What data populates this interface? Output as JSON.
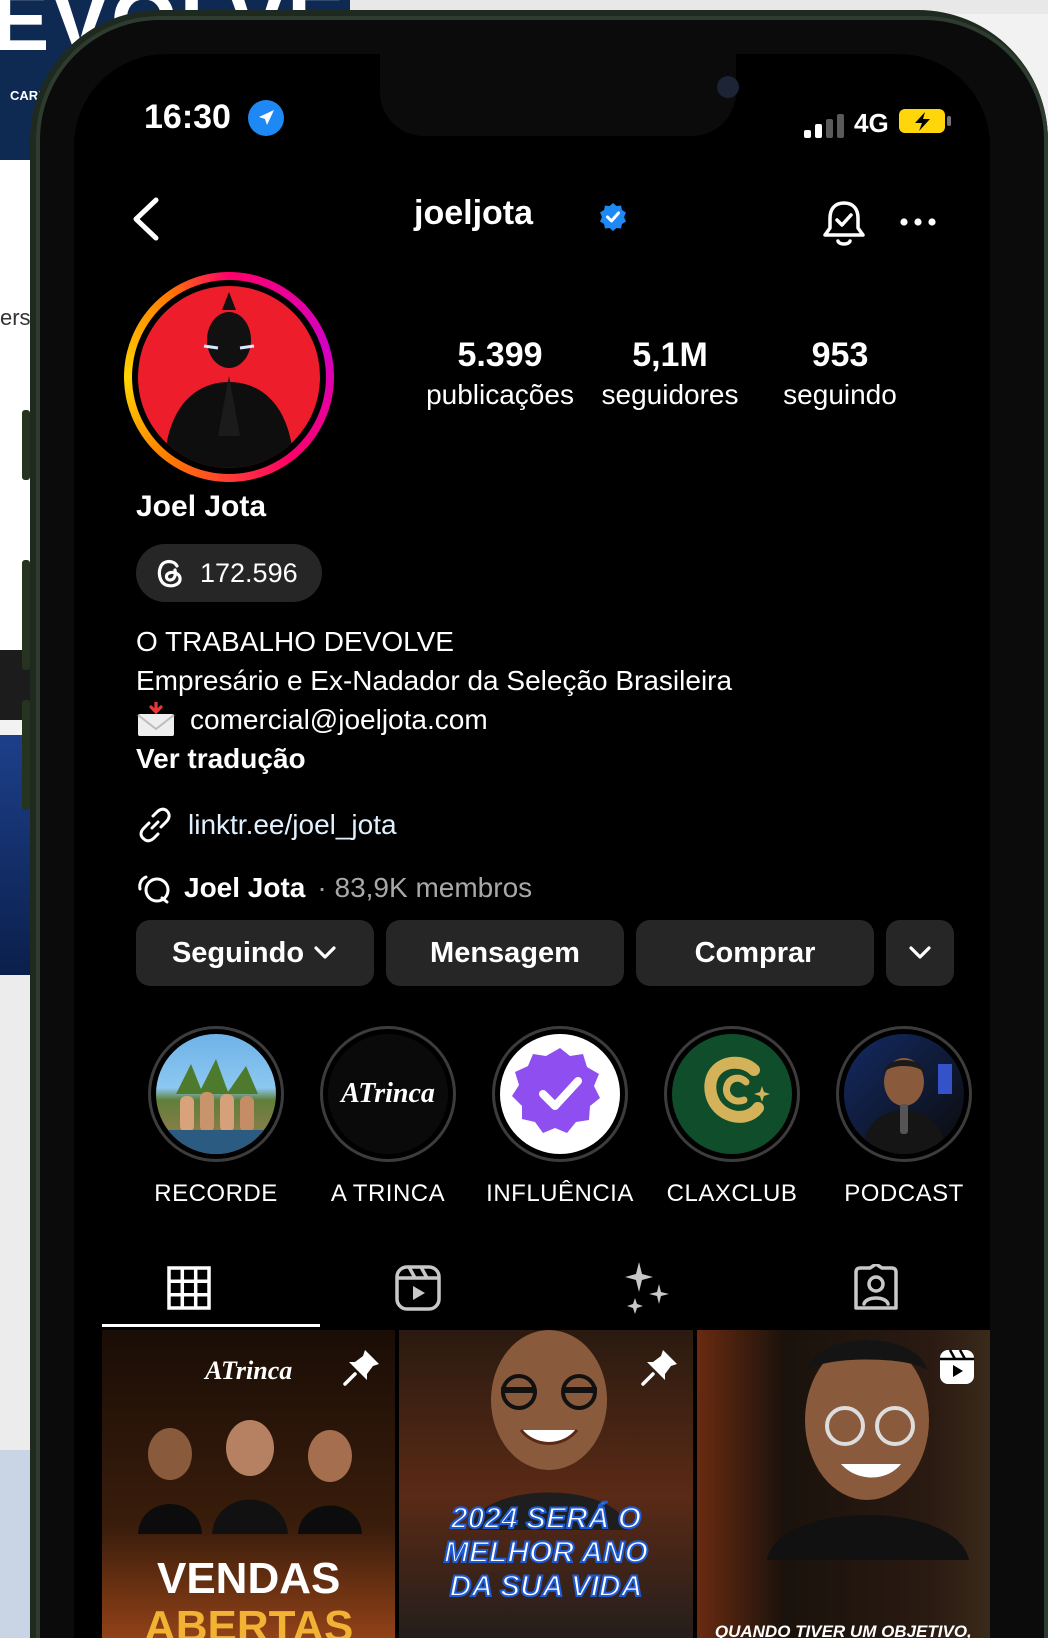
{
  "background": {
    "banner_text": "EVOLVE",
    "strip_text": "CARF",
    "snippet_text": "ersi"
  },
  "status_bar": {
    "time": "16:30",
    "network": "4G"
  },
  "header": {
    "username": "joeljota"
  },
  "profile": {
    "stats": [
      {
        "value": "5.399",
        "label": "publicações"
      },
      {
        "value": "5,1M",
        "label": "seguidores"
      },
      {
        "value": "953",
        "label": "seguindo"
      }
    ],
    "name": "Joel Jota",
    "threads_count": "172.596",
    "bio": {
      "line1": "O TRABALHO DEVOLVE",
      "line2": "Empresário e Ex-Nadador da Seleção Brasileira",
      "email": "comercial@joeljota.com",
      "translate": "Ver tradução"
    },
    "link": "linktr.ee/joel_jota",
    "community": {
      "name": "Joel Jota",
      "meta": "· 83,9K membros"
    }
  },
  "actions": {
    "following": "Seguindo",
    "message": "Mensagem",
    "shop": "Comprar"
  },
  "highlights": [
    {
      "label": "RECORDE"
    },
    {
      "label": "A TRINCA",
      "logo_text": "ATrinca"
    },
    {
      "label": "INFLUÊNCIA"
    },
    {
      "label": "CLAXCLUB"
    },
    {
      "label": "PODCAST"
    }
  ],
  "tabs": [
    "grid-icon",
    "reels-icon",
    "sparkles-icon",
    "tagged-icon"
  ],
  "posts": [
    {
      "top_text": "ATrinca",
      "caption1": "VENDAS",
      "caption2": "ABERTAS",
      "badge": "pin-icon"
    },
    {
      "caption1": "2024 SERÁ O",
      "caption2": "MELHOR ANO",
      "caption3": "DA SUA VIDA",
      "badge": "pin-icon"
    },
    {
      "caption1": "QUANDO TIVER UM OBJETIVO,",
      "badge": "reel-icon"
    }
  ],
  "colors": {
    "accent_blue": "#1e88f5",
    "story_gradient": "#ff0069",
    "avatar_bg": "#ee1d2b",
    "button_bg": "#262626"
  }
}
